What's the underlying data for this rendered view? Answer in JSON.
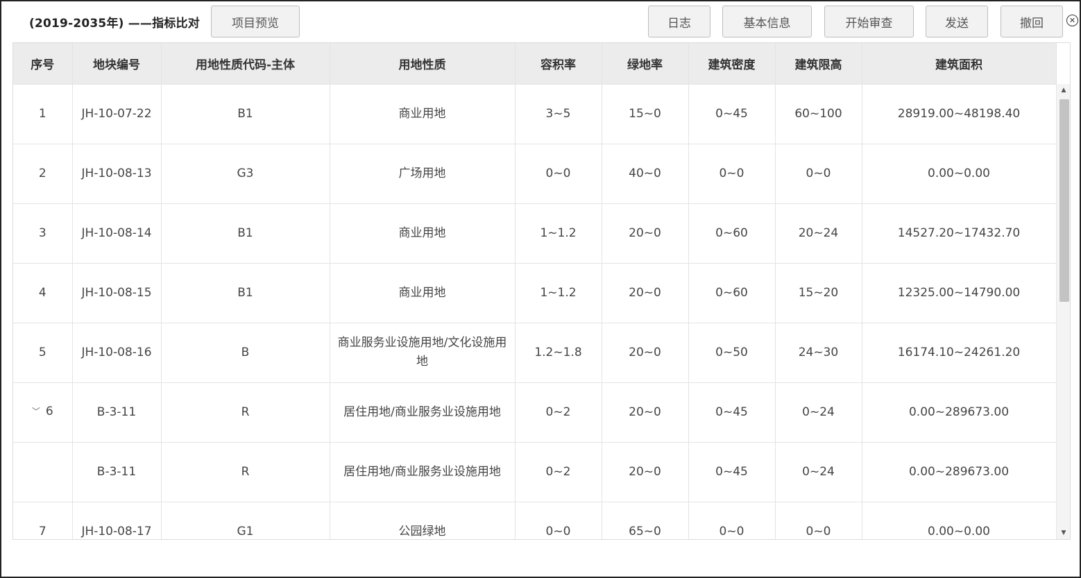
{
  "header": {
    "title": "(2019-2035年) ——指标比对",
    "preview_button": "项目预览",
    "log_button": "日志",
    "info_button": "基本信息",
    "review_button": "开始审查",
    "send_button": "发送",
    "revoke_button": "撤回",
    "close_icon": "⊗"
  },
  "table": {
    "columns": [
      "序号",
      "地块编号",
      "用地性质代码-主体",
      "用地性质",
      "容积率",
      "绿地率",
      "建筑密度",
      "建筑限高",
      "建筑面积"
    ],
    "rows": [
      {
        "seq": "1",
        "plot": "JH-10-07-22",
        "code": "B1",
        "nature": "商业用地",
        "far": "3~5",
        "green": "15~0",
        "density": "0~45",
        "height": "60~100",
        "area": "28919.00~48198.40"
      },
      {
        "seq": "2",
        "plot": "JH-10-08-13",
        "code": "G3",
        "nature": "广场用地",
        "far": "0~0",
        "green": "40~0",
        "density": "0~0",
        "height": "0~0",
        "area": "0.00~0.00"
      },
      {
        "seq": "3",
        "plot": "JH-10-08-14",
        "code": "B1",
        "nature": "商业用地",
        "far": "1~1.2",
        "green": "20~0",
        "density": "0~60",
        "height": "20~24",
        "area": "14527.20~17432.70"
      },
      {
        "seq": "4",
        "plot": "JH-10-08-15",
        "code": "B1",
        "nature": "商业用地",
        "far": "1~1.2",
        "green": "20~0",
        "density": "0~60",
        "height": "15~20",
        "area": "12325.00~14790.00"
      },
      {
        "seq": "5",
        "plot": "JH-10-08-16",
        "code": "B",
        "nature": "商业服务业设施用地/文化设施用地",
        "far": "1.2~1.8",
        "green": "20~0",
        "density": "0~50",
        "height": "24~30",
        "area": "16174.10~24261.20"
      },
      {
        "seq": "6",
        "expand_icon": "﹀",
        "plot": "B-3-11",
        "code": "R",
        "nature": "居住用地/商业服务业设施用地",
        "far": "0~2",
        "green": "20~0",
        "density": "0~45",
        "height": "0~24",
        "area": "0.00~289673.00"
      },
      {
        "seq": "",
        "plot": "B-3-11",
        "code": "R",
        "nature": "居住用地/商业服务业设施用地",
        "far": "0~2",
        "green": "20~0",
        "density": "0~45",
        "height": "0~24",
        "area": "0.00~289673.00"
      },
      {
        "seq": "7",
        "plot": "JH-10-08-17",
        "code": "G1",
        "nature": "公园绿地",
        "far": "0~0",
        "green": "65~0",
        "density": "0~0",
        "height": "0~0",
        "area": "0.00~0.00"
      }
    ]
  },
  "scrollbar": {
    "up_arrow": "▲",
    "down_arrow": "▼"
  }
}
